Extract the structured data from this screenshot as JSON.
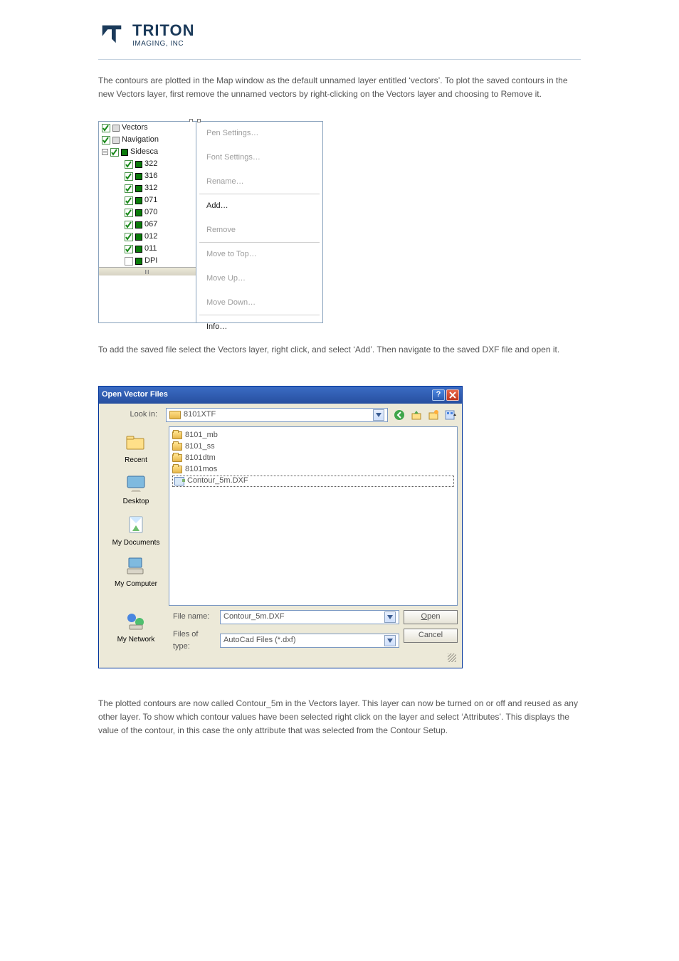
{
  "logo": {
    "brand": "TRITON",
    "sub": "IMAGING, INC"
  },
  "body": {
    "p1_a": "The contours are plotted in the Map window as the default unnamed layer entitled ",
    "p1_q": "‘vectors’",
    "p1_b": ". To plot the saved contours in the new Vectors layer, first remove the unnamed vectors by right-clicking on the Vectors layer and choosing to Remove it.",
    "p2_a": "To add the saved file select the Vectors layer, right click, and select ",
    "p2_q": "‘Add’",
    "p2_b": ". Then navigate to the saved DXF file and open it.",
    "p3_a": "The plotted contours are now called Contour_5m in the Vectors layer.  This layer can now be turned on or off and reused as any other layer.  To show which contour values have been selected right click on the layer and select ",
    "p3_q": "‘Attributes’",
    "p3_b": ".  This displays the value of the contour, in this case the only attribute that was selected from the Contour Setup."
  },
  "tree": {
    "root1": "Vectors",
    "root2": "Navigation",
    "root3": "Sidesca",
    "leaves": [
      "322",
      "316",
      "312",
      "071",
      "070",
      "067",
      "012",
      "011"
    ],
    "dpi": "DPI"
  },
  "menu": {
    "pen": "Pen Settings…",
    "font": "Font Settings…",
    "rename": "Rename…",
    "add": "Add…",
    "remove": "Remove",
    "top": "Move to Top…",
    "up": "Move Up…",
    "down": "Move Down…",
    "info": "Info…"
  },
  "dialog": {
    "title": "Open Vector Files",
    "lookin_label": "Look in:",
    "lookin_value": "8101XTF",
    "places": {
      "recent": "Recent",
      "desktop": "Desktop",
      "docs": "My Documents",
      "comp": "My Computer",
      "net": "My Network"
    },
    "files": [
      "8101_mb",
      "8101_ss",
      "8101dtm",
      "8101mos"
    ],
    "file_selected": "Contour_5m.DXF",
    "filename_label": "File name:",
    "filename_value": "Contour_5m.DXF",
    "filetype_label": "Files of type:",
    "filetype_value": "AutoCad Files (*.dxf)",
    "open": "Open",
    "cancel": "Cancel",
    "help": "?",
    "close": "✕"
  }
}
